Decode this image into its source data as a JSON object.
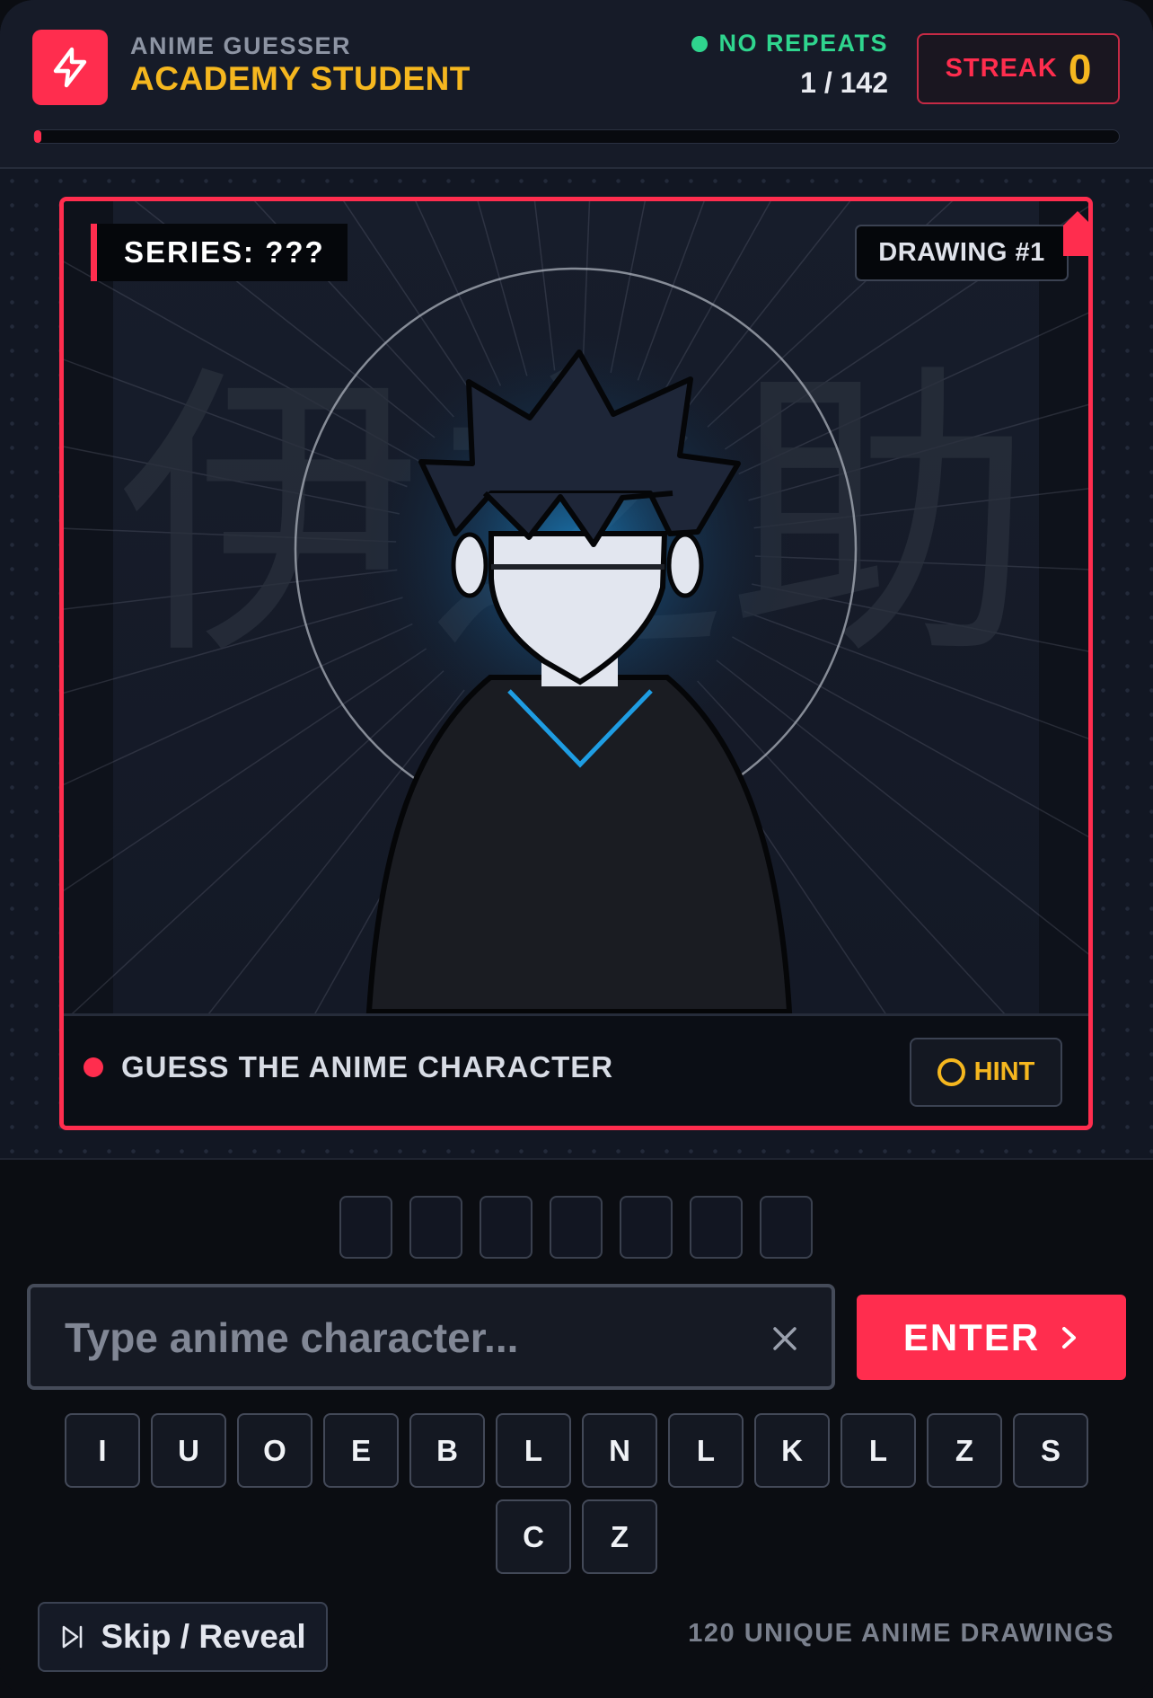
{
  "header": {
    "app_name": "ANIME GUESSER",
    "rank_title": "ACADEMY STUDENT",
    "mode_label": "NO REPEATS",
    "progress_text": "1 / 142",
    "progress_fraction": 0.007,
    "streak_label": "STREAK",
    "streak_value": "0"
  },
  "card": {
    "series_label": "SERIES: ???",
    "drawing_label": "DRAWING #1",
    "background_kanji": "伊之助",
    "prompt": "GUESS THE ANIME CHARACTER",
    "hint_label": "HINT"
  },
  "answer": {
    "slot_count": 7
  },
  "input": {
    "placeholder": "Type anime character...",
    "value": "",
    "clear_icon": "close-icon",
    "enter_label": "ENTER"
  },
  "keyboard": {
    "rows": [
      [
        "I",
        "U",
        "O",
        "E",
        "B",
        "L",
        "N",
        "L",
        "K",
        "L",
        "Z",
        "S"
      ],
      [
        "C",
        "Z"
      ]
    ]
  },
  "footer": {
    "skip_label": "Skip / Reveal",
    "note": "120 UNIQUE ANIME DRAWINGS"
  },
  "colors": {
    "accent": "#ff2d4e",
    "gold": "#f5b71f",
    "status_green": "#2fd58e",
    "glow_blue": "#1a8fd6"
  },
  "icons": {
    "logo": "lightning-bolt-icon",
    "hint": "circle-icon",
    "enter": "chevron-right-icon",
    "skip": "skip-forward-icon"
  }
}
